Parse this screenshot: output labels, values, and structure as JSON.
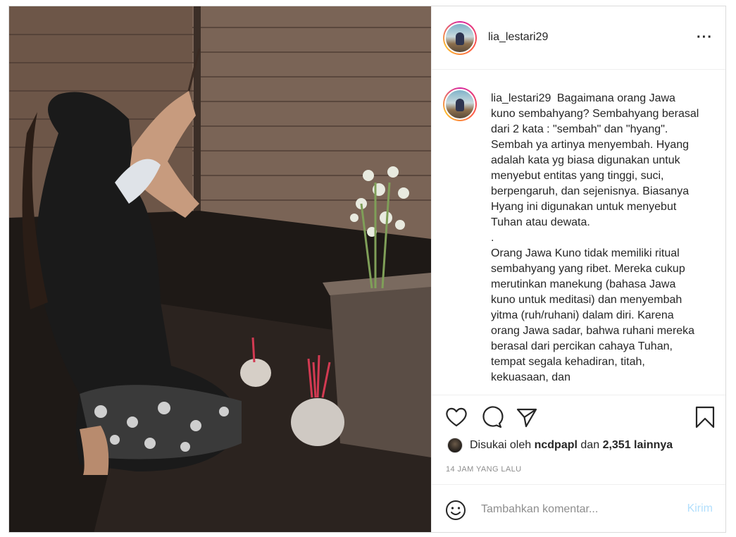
{
  "post": {
    "username": "lia_lestari29",
    "caption": "Bagaimana orang Jawa kuno sembahyang? Sembahyang berasal dari 2 kata : \"sembah\" dan \"hyang\". Sembah ya artinya menyembah. Hyang adalah kata yg biasa digunakan untuk menyebut entitas yang tinggi, suci, berpengaruh, dan sejenisnya. Biasanya Hyang ini digunakan untuk menyebut Tuhan atau dewata.\n.\nOrang Jawa Kuno tidak memiliki ritual sembahyang yang ribet. Mereka cukup merutinkan manekung (bahasa Jawa kuno untuk meditasi) dan menyembah yitma (ruh/ruhani) dalam diri. Karena orang Jawa sadar, bahwa ruhani mereka berasal dari percikan cahaya Tuhan, tempat segala kehadiran, titah, kekuasaan, dan",
    "likes": {
      "prefix": "Disukai oleh",
      "user": "ncdpapl",
      "middle": "dan",
      "count": "2,351 lainnya"
    },
    "time_ago": "14 JAM YANG LALU"
  },
  "comment": {
    "placeholder": "Tambahkan komentar...",
    "post_label": "Kirim"
  },
  "icons": {
    "more": "more-options-icon",
    "like": "heart-icon",
    "comment": "comment-icon",
    "share": "paper-plane-icon",
    "save": "bookmark-icon",
    "emoji": "smiley-icon"
  },
  "colors": {
    "border": "#dbdbdb",
    "muted": "#8e8e8e",
    "post_button": "#b2dffc",
    "text": "#262626"
  }
}
